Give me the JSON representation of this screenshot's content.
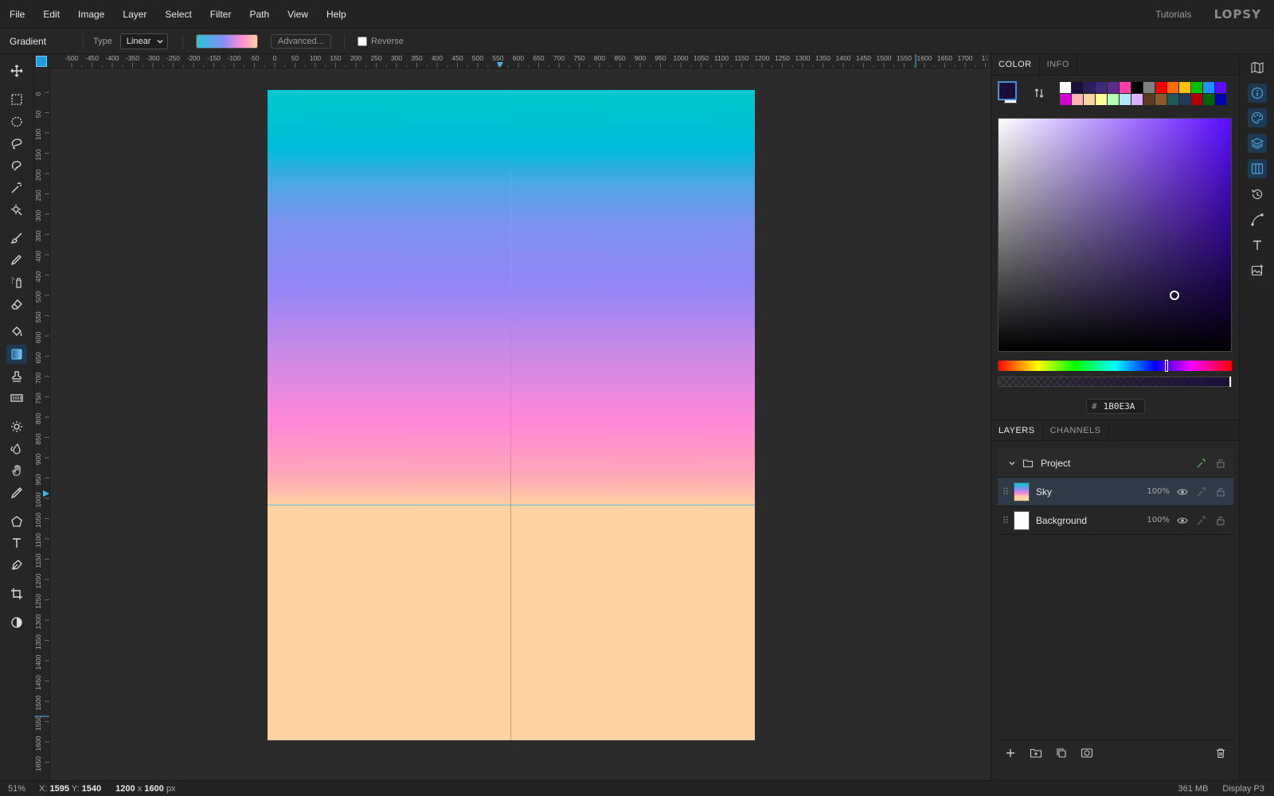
{
  "menu": [
    "File",
    "Edit",
    "Image",
    "Layer",
    "Select",
    "Filter",
    "Path",
    "View",
    "Help"
  ],
  "header": {
    "tutorials": "Tutorials",
    "logo": "LOPSY"
  },
  "options": {
    "tool_name": "Gradient",
    "type_label": "Type",
    "type_value": "Linear",
    "advanced_label": "Advanced...",
    "reverse_label": "Reverse",
    "reverse_checked": false
  },
  "tools": [
    "move-icon",
    "rect-select-icon",
    "ellipse-select-icon",
    "lasso-icon",
    "magnetic-lasso-icon",
    "magic-wand-icon",
    "quick-select-icon",
    "brush-icon",
    "pencil-icon",
    "spray-icon",
    "eraser-icon",
    "paint-bucket-icon",
    "gradient-icon",
    "stamp-icon",
    "pattern-icon",
    "brightness-icon",
    "blur-icon",
    "hand-smudge-icon",
    "eyedropper-icon",
    "polygon-icon",
    "text-icon",
    "pen-icon",
    "crop-icon",
    "contrast-icon"
  ],
  "ruler": {
    "h_labels": [
      "-500",
      "-450",
      "-400",
      "-350",
      "-300",
      "-250",
      "-200",
      "-150",
      "-100",
      "-50",
      "0",
      "50",
      "100",
      "150",
      "200",
      "250",
      "300",
      "350",
      "400",
      "450",
      "500",
      "550",
      "600",
      "650",
      "700",
      "750",
      "800",
      "850",
      "900",
      "950",
      "1000",
      "1050",
      "1100",
      "1150",
      "1200",
      "1250",
      "1300",
      "1350",
      "1400",
      "1450",
      "1500",
      "1550",
      "1600",
      "1650",
      "1700",
      "17"
    ],
    "v_labels": [
      "0",
      "50",
      "100",
      "150",
      "200",
      "250",
      "300",
      "350",
      "400",
      "450",
      "500",
      "550",
      "600",
      "650",
      "700",
      "750",
      "800",
      "850",
      "900",
      "950",
      "1000",
      "1050",
      "1100",
      "1150",
      "1200",
      "1250",
      "1300",
      "1350",
      "1400",
      "1450",
      "1500",
      "1550",
      "1600",
      "1650"
    ]
  },
  "color_panel": {
    "tabs": [
      "COLOR",
      "INFO"
    ],
    "active_tab": "COLOR",
    "foreground": "#1B0E3A",
    "background": "#FFFFFF",
    "hex_value": "1B0E3A",
    "hash": "#",
    "swatches": [
      "#ffffff",
      "#1b0e3a",
      "#2a1f5a",
      "#3d2a7a",
      "#5a2d8c",
      "#ff3fa6",
      "#000000",
      "#808080",
      "#ff0000",
      "#ff6a00",
      "#ffc000",
      "#00c000",
      "#1e90ff",
      "#5a0cff",
      "#d400d4",
      "#ffb3b3",
      "#ffd2a3",
      "#ffff99",
      "#b3ffb3",
      "#b3e5ff",
      "#d9b3ff",
      "#5c3a1e",
      "#8b5a2b",
      "#1e5a5a",
      "#1e3a5a",
      "#b30000",
      "#006400",
      "#0000b3"
    ]
  },
  "layers_panel": {
    "tabs": [
      "LAYERS",
      "CHANNELS"
    ],
    "active_tab": "LAYERS",
    "group": {
      "name": "Project"
    },
    "layers": [
      {
        "name": "Sky",
        "opacity": "100%",
        "selected": true
      },
      {
        "name": "Background",
        "opacity": "100%",
        "selected": false
      }
    ]
  },
  "right_strip": [
    "map-icon",
    "info-icon",
    "palette-icon",
    "layers-icon",
    "channels-icon",
    "history-icon",
    "path-icon",
    "text-tool-icon",
    "image-add-icon"
  ],
  "status": {
    "zoom": "51%",
    "x_label": "X:",
    "x_value": "1595",
    "y_label": "Y:",
    "y_value": "1540",
    "doc_w": "1200",
    "doc_x": "x",
    "doc_h": "1600",
    "doc_unit": "px",
    "memory": "361 MB",
    "profile": "Display P3"
  }
}
